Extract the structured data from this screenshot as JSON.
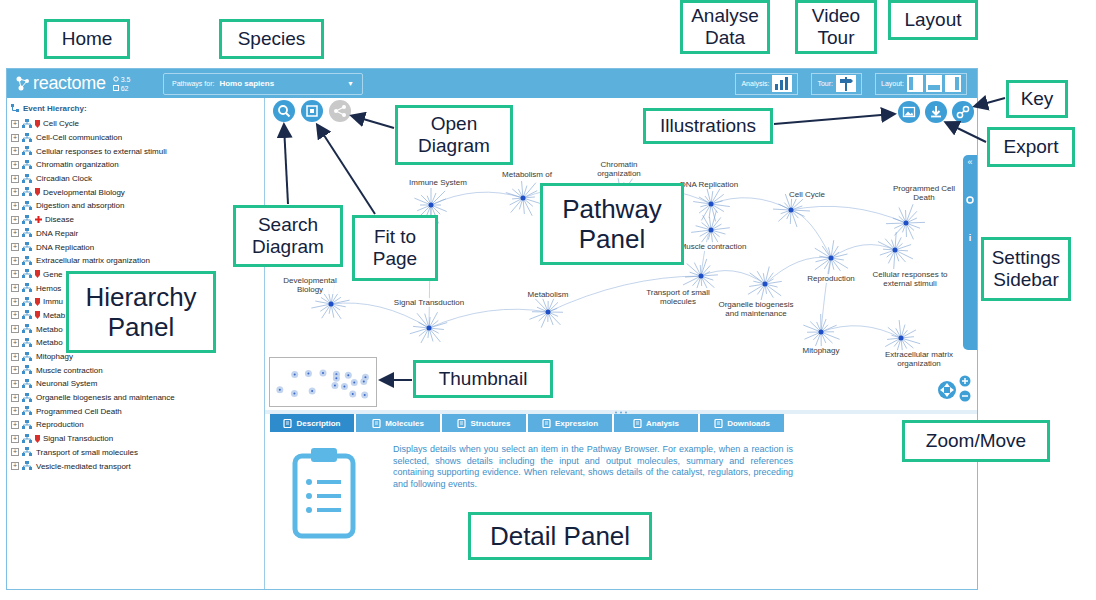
{
  "app": {
    "logo": "reactome",
    "version": "3.5",
    "count": "62",
    "species_label": "Pathways for:",
    "species": "Homo sapiens",
    "species_caret": "▼",
    "analysis_label": "Analysis:",
    "tour_label": "Tour:",
    "layout_label": "Layout:"
  },
  "hierarchy": {
    "title": "Event Hierarchy:",
    "expander": "+",
    "items": [
      {
        "label": "Cell Cycle",
        "kind": "flagged"
      },
      {
        "label": "Cell-Cell communication",
        "kind": "plain"
      },
      {
        "label": "Cellular responses to external stimuli",
        "kind": "plain"
      },
      {
        "label": "Chromatin organization",
        "kind": "plain"
      },
      {
        "label": "Circadian Clock",
        "kind": "plain"
      },
      {
        "label": "Developmental Biology",
        "kind": "flagged"
      },
      {
        "label": "Digestion and absorption",
        "kind": "plain"
      },
      {
        "label": "Disease",
        "kind": "disease"
      },
      {
        "label": "DNA Repair",
        "kind": "plain"
      },
      {
        "label": "DNA Replication",
        "kind": "plain"
      },
      {
        "label": "Extracellular matrix organization",
        "kind": "plain"
      },
      {
        "label": "Gene",
        "kind": "flagged"
      },
      {
        "label": "Hemos",
        "kind": "plain"
      },
      {
        "label": "Immu",
        "kind": "flagged"
      },
      {
        "label": "Metab",
        "kind": "flagged"
      },
      {
        "label": "Metabo",
        "kind": "plain"
      },
      {
        "label": "Metabo",
        "kind": "plain"
      },
      {
        "label": "Mitophagy",
        "kind": "plain"
      },
      {
        "label": "Muscle contraction",
        "kind": "plain"
      },
      {
        "label": "Neuronal System",
        "kind": "plain"
      },
      {
        "label": "Organelle biogenesis and maintenance",
        "kind": "plain"
      },
      {
        "label": "Programmed Cell Death",
        "kind": "plain"
      },
      {
        "label": "Reproduction",
        "kind": "plain"
      },
      {
        "label": "Signal Transduction",
        "kind": "flagged"
      },
      {
        "label": "Transport of small molecules",
        "kind": "plain"
      },
      {
        "label": "Vesicle-mediated transport",
        "kind": "plain"
      }
    ]
  },
  "diagram": {
    "nodes": [
      {
        "label": "Immune System"
      },
      {
        "label": "Metabolism of"
      },
      {
        "label": "Chromatin organization"
      },
      {
        "label": "DNA Replication"
      },
      {
        "label": "Cell Cycle"
      },
      {
        "label": "Programmed Cell Death"
      },
      {
        "label": "Muscle contraction"
      },
      {
        "label": "Developmental Biology"
      },
      {
        "label": "Signal Transduction"
      },
      {
        "label": "Metabolism"
      },
      {
        "label": "Transport of small molecules"
      },
      {
        "label": "Organelle biogenesis and maintenance"
      },
      {
        "label": "Reproduction"
      },
      {
        "label": "Cellular responses to external stimuli"
      },
      {
        "label": "Mitophagy"
      },
      {
        "label": "Extracellular matrix organization"
      }
    ],
    "sidebar": {
      "collapse": "«",
      "info": "i"
    }
  },
  "detail": {
    "tabs": [
      {
        "label": "Description",
        "selected": true
      },
      {
        "label": "Molecules",
        "selected": false
      },
      {
        "label": "Structures",
        "selected": false
      },
      {
        "label": "Expression",
        "selected": false
      },
      {
        "label": "Analysis",
        "selected": false
      },
      {
        "label": "Downloads",
        "selected": false
      }
    ],
    "text": "Displays details when you select an item in the Pathway Browser. For example, when a reaction is selected, shows details including the input and output molecules, summary and references containing supporting evidence. When relevant, shows details of the catalyst, regulators, preceding and following events."
  },
  "callouts": [
    {
      "label": "Home",
      "kind": "small"
    },
    {
      "label": "Species",
      "kind": "small"
    },
    {
      "label": "Analyse Data",
      "kind": "small"
    },
    {
      "label": "Video Tour",
      "kind": "small"
    },
    {
      "label": "Layout",
      "kind": "small"
    },
    {
      "label": "Key",
      "kind": "small"
    },
    {
      "label": "Illustrations",
      "kind": "small"
    },
    {
      "label": "Export",
      "kind": "small"
    },
    {
      "label": "Open Diagram",
      "kind": "small"
    },
    {
      "label": "Search Diagram",
      "kind": "small"
    },
    {
      "label": "Fit to Page",
      "kind": "small"
    },
    {
      "label": "Pathway Panel",
      "kind": "large"
    },
    {
      "label": "Settings Sidebar",
      "kind": "small"
    },
    {
      "label": "Hierarchy Panel",
      "kind": "large"
    },
    {
      "label": "Thumbnail",
      "kind": "small"
    },
    {
      "label": "Zoom/Move",
      "kind": "small"
    },
    {
      "label": "Detail Panel",
      "kind": "large"
    }
  ]
}
